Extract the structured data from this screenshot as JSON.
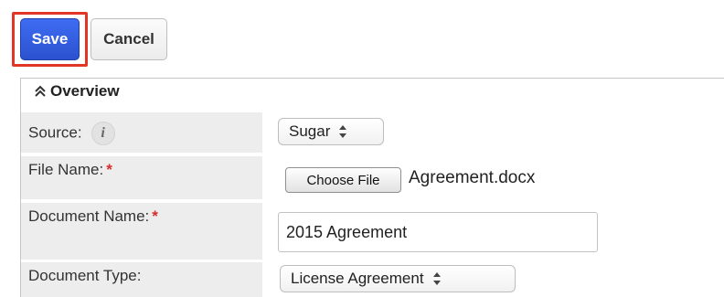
{
  "toolbar": {
    "save_label": "Save",
    "cancel_label": "Cancel",
    "highlight_color": "#e33526",
    "save_color": "#2f59dc"
  },
  "panel": {
    "title": "Overview",
    "collapse_icon": "chevron-double-up-icon"
  },
  "fields": {
    "source": {
      "label": "Source:",
      "info_icon": "info-icon",
      "info_glyph": "i",
      "value": "Sugar"
    },
    "file_name": {
      "label": "File Name:",
      "required_mark": "*",
      "button_label": "Choose File",
      "value": "Agreement.docx"
    },
    "document_name": {
      "label": "Document Name:",
      "required_mark": "*",
      "value": "2015 Agreement"
    },
    "document_type": {
      "label": "Document Type:",
      "value": "License Agreement"
    }
  },
  "colors": {
    "required": "#d62c2c",
    "label_bg": "#ededed"
  }
}
